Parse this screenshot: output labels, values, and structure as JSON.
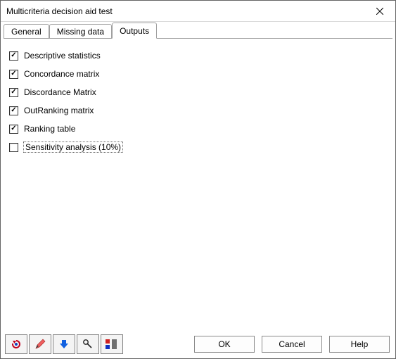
{
  "titlebar": {
    "title": "Multicriteria decision aid test"
  },
  "tabs": [
    {
      "label": "General",
      "active": false
    },
    {
      "label": "Missing data",
      "active": false
    },
    {
      "label": "Outputs",
      "active": true
    }
  ],
  "outputs": [
    {
      "label": "Descriptive statistics",
      "checked": true,
      "focused": false
    },
    {
      "label": "Concordance matrix",
      "checked": true,
      "focused": false
    },
    {
      "label": "Discordance Matrix",
      "checked": true,
      "focused": false
    },
    {
      "label": "OutRanking matrix",
      "checked": true,
      "focused": false
    },
    {
      "label": "Ranking table",
      "checked": true,
      "focused": false
    },
    {
      "label": "Sensitivity analysis (10%)",
      "checked": false,
      "focused": true
    }
  ],
  "toolbar": {
    "reset_icon": "reset-icon",
    "pencil_icon": "pencil-icon",
    "down_icon": "down-arrow-icon",
    "wand_icon": "wand-icon",
    "palette_icon": "palette-icon"
  },
  "buttons": {
    "ok": "OK",
    "cancel": "Cancel",
    "help": "Help"
  }
}
